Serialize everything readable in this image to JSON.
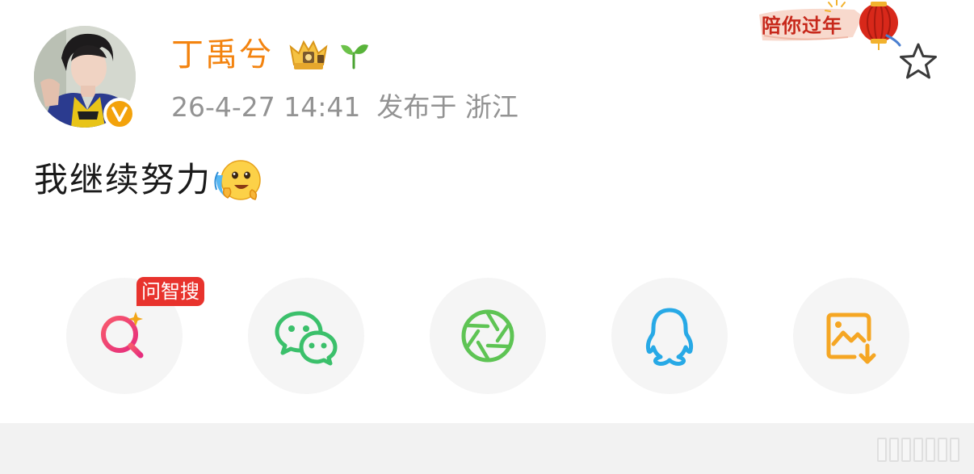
{
  "author": {
    "name": "丁禹兮",
    "verified_mark": "V",
    "badges": [
      "crown-badge-icon",
      "sprout-badge-icon"
    ]
  },
  "post": {
    "date": "26-4-27 14:41",
    "location": "发布于 浙江",
    "text": "我继续努力",
    "emoji": "crying-laughing-emoji"
  },
  "festive_banner": {
    "text": "陪你过年"
  },
  "share": {
    "ai_tag": "问智搜",
    "items": [
      {
        "icon": "ai-search-icon"
      },
      {
        "icon": "wechat-icon"
      },
      {
        "icon": "moments-aperture-icon"
      },
      {
        "icon": "qq-icon"
      },
      {
        "icon": "save-image-icon"
      }
    ]
  },
  "colors": {
    "username": "#f3830f",
    "meta": "#939393",
    "tag_red": "#e8332d",
    "wechat_green": "#3bc06b",
    "moments_green": "#5ec454",
    "qq_blue": "#27a9e6",
    "save_orange": "#f5a623"
  }
}
